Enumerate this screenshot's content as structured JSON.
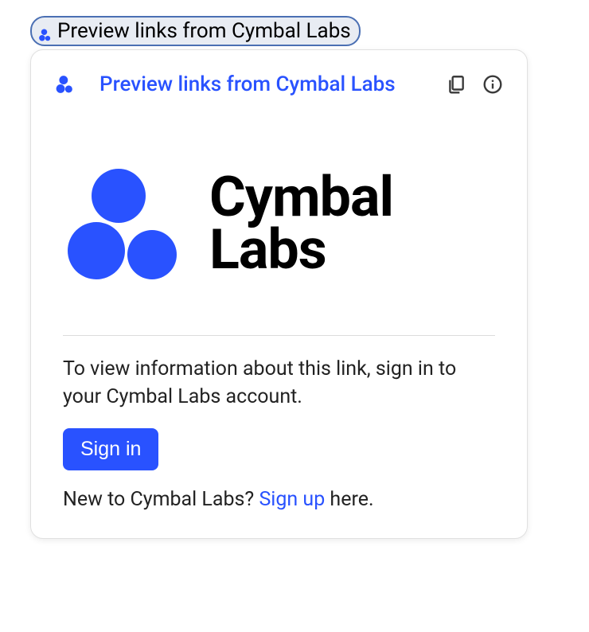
{
  "chip": {
    "label": "Preview links from Cymbal Labs"
  },
  "card": {
    "header": {
      "title": "Preview links from Cymbal Labs"
    },
    "logo": {
      "line1": "Cymbal",
      "line2": "Labs"
    },
    "body": {
      "instruction": "To view information about this link, sign in to your Cymbal Labs account.",
      "signin_button": "Sign in",
      "signup_prefix": "New to Cymbal Labs? ",
      "signup_link": "Sign up",
      "signup_suffix": " here."
    }
  },
  "icons": {
    "cymbal": "cymbal-logo-icon",
    "copy": "copy-icon",
    "info": "info-icon"
  },
  "colors": {
    "accent": "#2952ff",
    "chip_border": "#4a6fb3",
    "chip_bg": "#e8ecf3"
  }
}
